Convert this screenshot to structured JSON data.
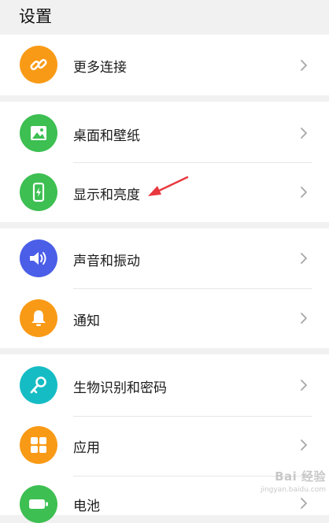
{
  "page": {
    "title": "设置"
  },
  "groups": [
    {
      "items": [
        {
          "label": "更多连接",
          "icon": "link-icon",
          "color": "#f99a16"
        }
      ]
    },
    {
      "items": [
        {
          "label": "桌面和壁纸",
          "icon": "image-icon",
          "color": "#3dbf52"
        },
        {
          "label": "显示和亮度",
          "icon": "phone-brightness-icon",
          "color": "#3dbf52"
        }
      ]
    },
    {
      "items": [
        {
          "label": "声音和振动",
          "icon": "speaker-icon",
          "color": "#4a5ee8"
        },
        {
          "label": "通知",
          "icon": "bell-icon",
          "color": "#f99a16"
        }
      ]
    },
    {
      "items": [
        {
          "label": "生物识别和密码",
          "icon": "key-icon",
          "color": "#16bcc4"
        },
        {
          "label": "应用",
          "icon": "grid-icon",
          "color": "#f99a16"
        },
        {
          "label": "电池",
          "icon": "battery-icon",
          "color": "#3dbf52"
        }
      ]
    }
  ],
  "annotation": {
    "icon": "red-arrow-icon",
    "color": "#e8383d"
  },
  "watermark": {
    "main": "Bai 经验",
    "sub": "jingyan.baidu.com"
  }
}
